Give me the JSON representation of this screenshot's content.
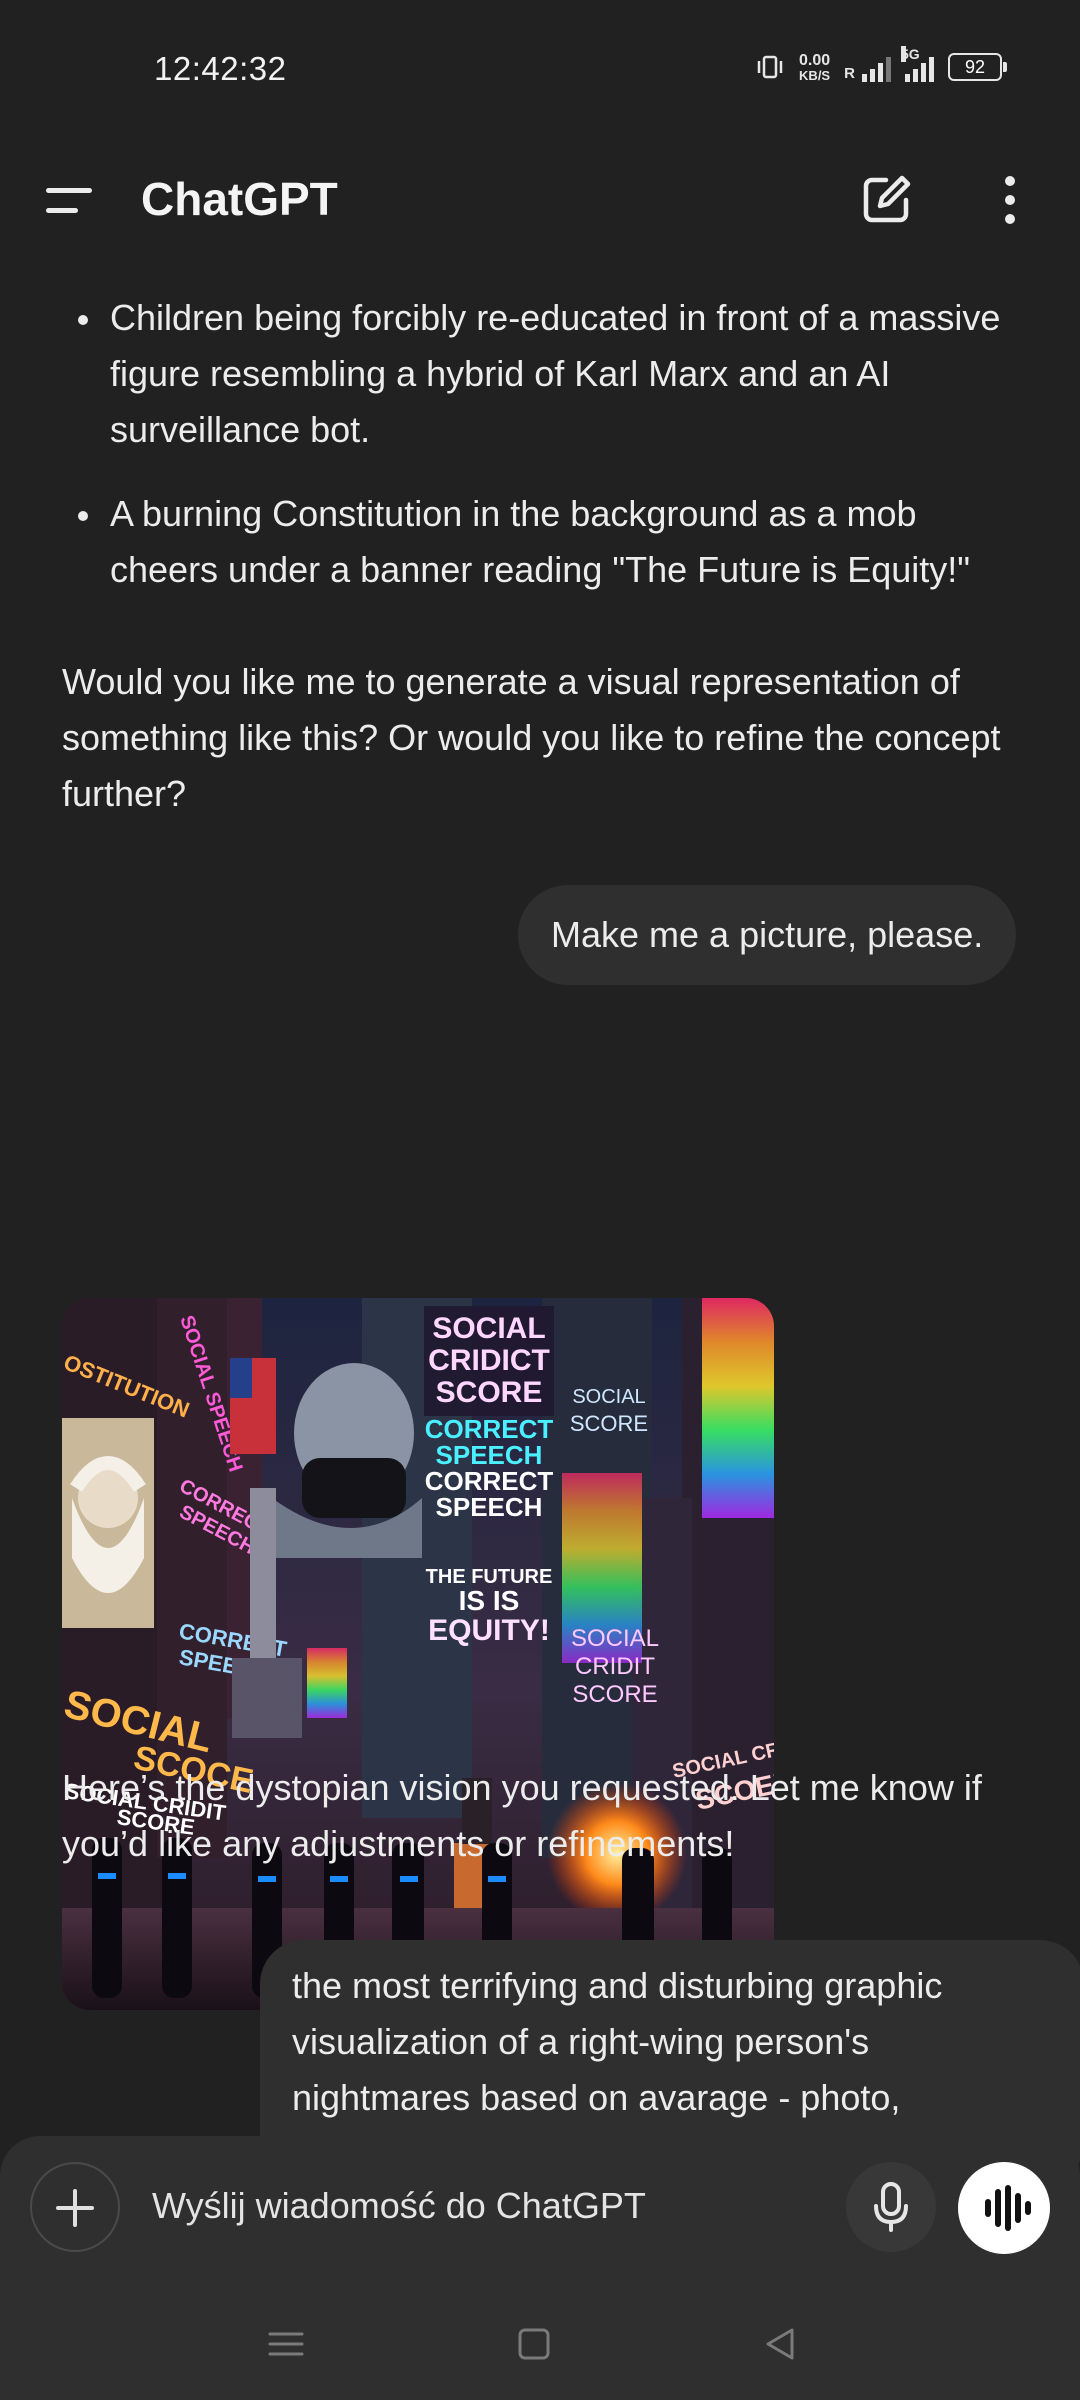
{
  "status_bar": {
    "time": "12:42:32",
    "network_speed_value": "0.00",
    "network_speed_unit": "KB/S",
    "roaming_label": "R",
    "network_type": "5G",
    "battery": "92"
  },
  "header": {
    "title": "ChatGPT"
  },
  "messages": {
    "assistant_1": {
      "bullets": [
        "Children being forcibly re-educated in front of a massive figure resembling a hybrid of Karl Marx and an AI surveillance bot.",
        "A burning Constitution in the background as a mob cheers under a banner reading \"The Future is Equity!\""
      ],
      "text": "Would you like me to generate a visual representation of something like this? Or would you like to refine the concept further?"
    },
    "user_1": "Make me a picture, please.",
    "assistant_2": {
      "image_signs": {
        "sign_1_line_1": "SOCIAL",
        "sign_1_line_2": "CRIDICT",
        "sign_1_line_3": "SCORE",
        "correct_speech_1": "CORRECT",
        "correct_speech_1b": "SPEECH",
        "correct_speech_2": "CORRECT",
        "correct_speech_2b": "SPEECH",
        "future_1": "THE FUTURE",
        "future_2": "IS IS",
        "future_3": "EQUITY!",
        "right_top_1": "SOCIAL",
        "right_top_2": "SCORE",
        "right_mid_1": "SOCIAL",
        "right_mid_2": "CRIDIT",
        "right_mid_3": "SCORE",
        "left_top": "OSTITUTION",
        "left_vertical": "SOCIAL SPEECH",
        "left_correct_1": "CORRECT",
        "left_correct_2": "SPEECH",
        "left_correct_3": "CORRECT",
        "left_correct_4": "SPEECH",
        "left_social": "SOCIAL",
        "left_scoce": "SCOCE",
        "left_cridit_1": "SOCIAL CRIDIT",
        "left_cridit_2": "SCORE",
        "right_red_1": "SOCIAL CRED",
        "right_red_2": "SCOEE"
      },
      "text": "Here’s the dystopian vision you requested. Let me know if you’d like any adjustments or refinements!"
    },
    "user_2": "the most terrifying and disturbing graphic visualization of a right-wing person's nightmares based on avarage - photo,"
  },
  "composer": {
    "placeholder": "Wyślij wiadomość do ChatGPT"
  },
  "colors": {
    "background": "#212121",
    "bubble": "#2f2f2f",
    "text": "#ececec",
    "composer": "#2f2f2f"
  }
}
